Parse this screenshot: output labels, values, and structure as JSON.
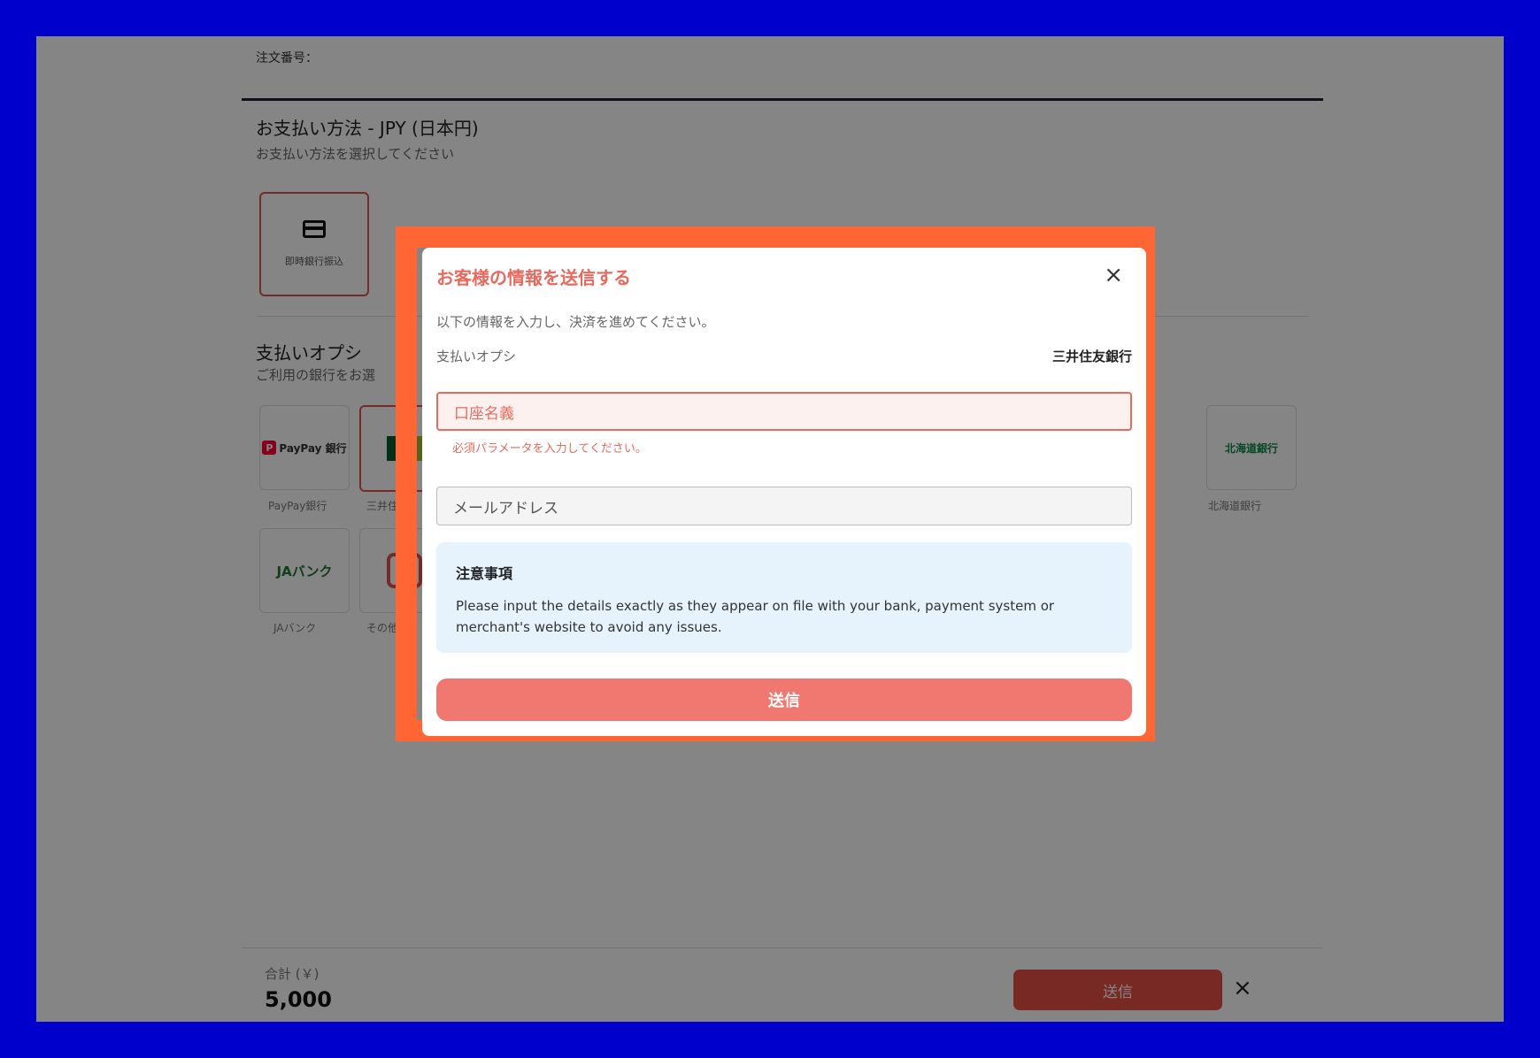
{
  "order": {
    "label": "注文番号："
  },
  "payment_method": {
    "title": "お支払い方法 - JPY (日本円)",
    "subtitle": "お支払い方法を選択してください",
    "card_label": "即時銀行振込"
  },
  "payment_options": {
    "title": "支払いオプシ",
    "subtitle": "ご利用の銀行をお選",
    "banks": [
      {
        "logo": "PayPay 銀行",
        "label": "PayPay銀行"
      },
      {
        "logo": "SMBC",
        "label": "三井住"
      },
      {
        "logo": "JAバンク",
        "label": "JAバンク"
      },
      {
        "logo": "その他",
        "label": "その他"
      },
      {
        "logo": "北海道銀行",
        "label": "北海道銀行"
      }
    ]
  },
  "footer": {
    "total_label": "合計 (￥)",
    "total_value": "5,000",
    "submit_label": "送信",
    "close_icon": "×"
  },
  "modal": {
    "title": "お客様の情報を送信する",
    "close_icon": "×",
    "instructions": "以下の情報を入力し、決済を進めてください。",
    "option_label": "支払いオプシ",
    "option_value": "三井住友銀行",
    "account_name_placeholder": "口座名義",
    "account_name_error": "必須パラメータを入力してください。",
    "email_placeholder": "メールアドレス",
    "notice_title": "注意事項",
    "notice_body": "Please input the details exactly as they appear on file with your bank, payment system or merchant's website to avoid any issues.",
    "submit_label": "送信"
  },
  "colors": {
    "frame": "#0000cc",
    "highlight": "#ff6633",
    "accent": "#e86a5e",
    "submit": "#f07870",
    "notice_bg": "#e6f3fc"
  }
}
